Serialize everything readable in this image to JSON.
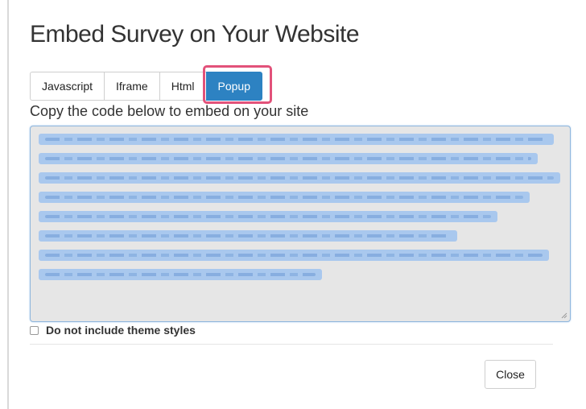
{
  "dialog": {
    "title": "Embed Survey on Your Website",
    "tabs": [
      {
        "label": "Javascript",
        "active": false
      },
      {
        "label": "Iframe",
        "active": false
      },
      {
        "label": "Html",
        "active": false
      },
      {
        "label": "Popup",
        "active": true
      }
    ],
    "instruction": "Copy the code below to embed on your site",
    "code_lines": 8,
    "checkbox": {
      "label": "Do not include theme styles",
      "checked": false
    },
    "close_label": "Close"
  },
  "colors": {
    "accent": "#2d82c2",
    "highlight": "#e2527a",
    "selection": "#a9c8ee",
    "textarea_bg": "#e6e6e6"
  }
}
